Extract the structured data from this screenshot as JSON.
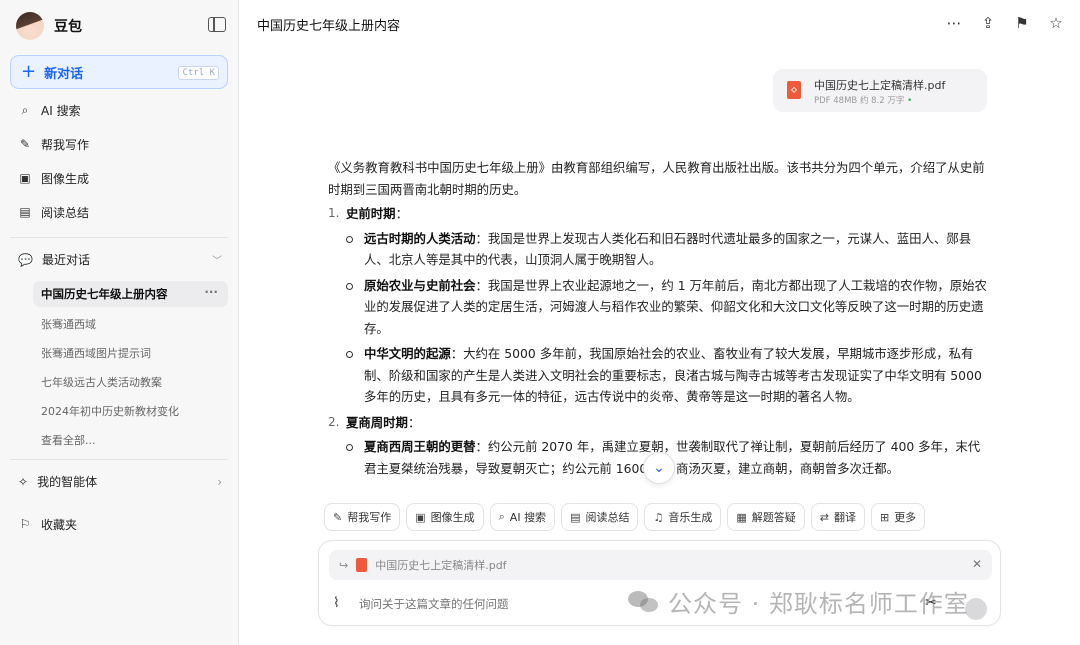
{
  "sidebar": {
    "brand": "豆包",
    "new_chat": {
      "label": "新对话",
      "shortcut": "Ctrl K"
    },
    "nav": [
      {
        "label": "AI 搜索",
        "icon": "ai-search-icon"
      },
      {
        "label": "帮我写作",
        "icon": "pen-icon"
      },
      {
        "label": "图像生成",
        "icon": "image-icon"
      },
      {
        "label": "阅读总结",
        "icon": "book-icon"
      }
    ],
    "recent": {
      "title": "最近对话",
      "active": "中国历史七年级上册内容",
      "items": [
        "张骞通西域",
        "张骞通西域图片提示词",
        "七年级远古人类活动教案",
        "2024年初中历史新教材变化",
        "查看全部..."
      ]
    },
    "agents": "我的智能体",
    "favorites": "收藏夹"
  },
  "header": {
    "title": "中国历史七年级上册内容"
  },
  "file": {
    "name": "中国历史七上定稿清样.pdf",
    "meta": "PDF 48MB 约 8.2 万字",
    "status": "•"
  },
  "answer": {
    "intro": "《义务教育教科书中国历史七年级上册》由教育部组织编写，人民教育出版社出版。该书共分为四个单元，介绍了从史前时期到三国两晋南北朝时期的历史。",
    "sections": [
      {
        "num": "1.",
        "title": "史前时期",
        "items": [
          {
            "head": "远古时期的人类活动",
            "text": "：我国是世界上发现古人类化石和旧石器时代遗址最多的国家之一，元谋人、蓝田人、郧县人、北京人等是其中的代表，山顶洞人属于晚期智人。"
          },
          {
            "head": "原始农业与史前社会",
            "text": "：我国是世界上农业起源地之一，约 1 万年前后，南北方都出现了人工栽培的农作物，原始农业的发展促进了人类的定居生活，河姆渡人与稻作农业的繁荣、仰韶文化和大汶口文化等反映了这一时期的历史遗存。"
          },
          {
            "head": "中华文明的起源",
            "text": "：大约在 5000 多年前，我国原始社会的农业、畜牧业有了较大发展，早期城市逐步形成，私有制、阶级和国家的产生是人类进入文明社会的重要标志，良渚古城与陶寺古城等考古发现证实了中华文明有 5000 多年的历史，且具有多元一体的特征，远古传说中的炎帝、黄帝等是这一时期的著名人物。"
          }
        ]
      },
      {
        "num": "2.",
        "title": "夏商周时期",
        "items": [
          {
            "head": "夏商西周王朝的更替",
            "text": "：约公元前 2070 年，禹建立夏朝，世袭制取代了禅让制，夏朝前后经历了 400 多年，末代君主夏桀统治残暴，导致夏朝灭亡；约公元前 1600 年，商汤灭夏，建立商朝，商朝曾多次迁都。"
          }
        ]
      }
    ]
  },
  "chips": [
    {
      "label": "帮我写作",
      "icon": "pen-icon"
    },
    {
      "label": "图像生成",
      "icon": "image-icon"
    },
    {
      "label": "AI 搜索",
      "icon": "ai-search-icon"
    },
    {
      "label": "阅读总结",
      "icon": "book-icon"
    },
    {
      "label": "音乐生成",
      "icon": "music-icon"
    },
    {
      "label": "解题答疑",
      "icon": "question-icon"
    },
    {
      "label": "翻译",
      "icon": "translate-icon"
    },
    {
      "label": "更多",
      "icon": "grid-icon"
    }
  ],
  "composer": {
    "quoted_file": "中国历史七上定稿清样.pdf",
    "placeholder": "询问关于这篇文章的任何问题"
  },
  "watermark": "公众号 · 郑耿标名师工作室"
}
